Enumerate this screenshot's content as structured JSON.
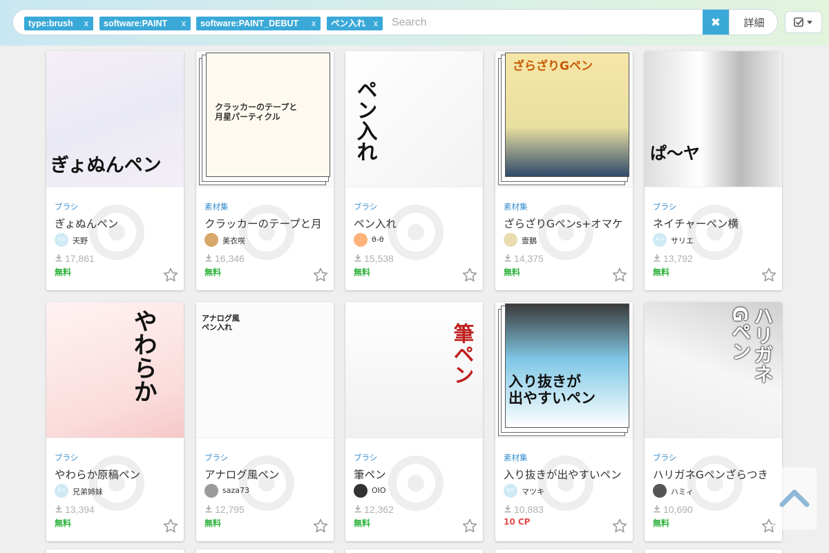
{
  "search": {
    "tags": [
      {
        "label": "type:brush",
        "remove": "x"
      },
      {
        "label": "software:PAINT",
        "remove": "x"
      },
      {
        "label": "software:PAINT_DEBUT",
        "remove": "x"
      },
      {
        "label": "ペン入れ",
        "remove": "x"
      }
    ],
    "placeholder": "Search",
    "clear_label": "✖",
    "detail_label": "詳細"
  },
  "colors": {
    "accent": "#3aa9d8",
    "free": "#2db13c",
    "paid": "#e24a4a",
    "category": "#3a8fd0"
  },
  "items": [
    {
      "category": "ブラシ",
      "title": "ぎょぬんペン",
      "author": "天野",
      "avatar_text": "N O",
      "downloads": "17,861",
      "price": "無料",
      "thumb_text": "ぎょぬんペン"
    },
    {
      "category": "素材集",
      "title": "クラッカーのテープと月",
      "author": "美衣咲",
      "avatar_text": "",
      "downloads": "16,346",
      "price": "無料",
      "thumb_text": "クラッカーのテープと\n月星パーティクル"
    },
    {
      "category": "ブラシ",
      "title": "ペン入れ",
      "author": "θ-θ",
      "avatar_text": "",
      "downloads": "15,538",
      "price": "無料",
      "thumb_text": "ペン入れ"
    },
    {
      "category": "素材集",
      "title": "ざらざりGペンs+オマケ",
      "author": "壹鵝",
      "avatar_text": "",
      "downloads": "14,375",
      "price": "無料",
      "thumb_text": "ざらざりGペン"
    },
    {
      "category": "ブラシ",
      "title": "ネイチャーペン横",
      "author": "サリエ",
      "avatar_text": "N O",
      "downloads": "13,792",
      "price": "無料",
      "thumb_text": "ぱ〜ヤ"
    },
    {
      "category": "ブラシ",
      "title": "やわらか原稿ペン",
      "author": "兄弟姉妹",
      "avatar_text": "N O",
      "downloads": "13,394",
      "price": "無料",
      "thumb_text": "やわらか"
    },
    {
      "category": "ブラシ",
      "title": "アナログ風ペン",
      "author": "saza73",
      "avatar_text": "",
      "downloads": "12,795",
      "price": "無料",
      "thumb_text": "アナログ風\nペン入れ"
    },
    {
      "category": "ブラシ",
      "title": "筆ペン",
      "author": "OIO",
      "avatar_text": "",
      "downloads": "12,362",
      "price": "無料",
      "thumb_text": "筆ペン"
    },
    {
      "category": "素材集",
      "title": "入り抜きが出やすいペン",
      "author": "マツキ",
      "avatar_text": "N O",
      "downloads": "10,883",
      "price": "10 CP",
      "thumb_text": "入り抜きが\n出やすいペン"
    },
    {
      "category": "ブラシ",
      "title": "ハリガネGペンざらつき",
      "author": "ハミィ",
      "avatar_text": "",
      "downloads": "10,690",
      "price": "無料",
      "thumb_text": "ハリガネ\nGペン"
    }
  ]
}
